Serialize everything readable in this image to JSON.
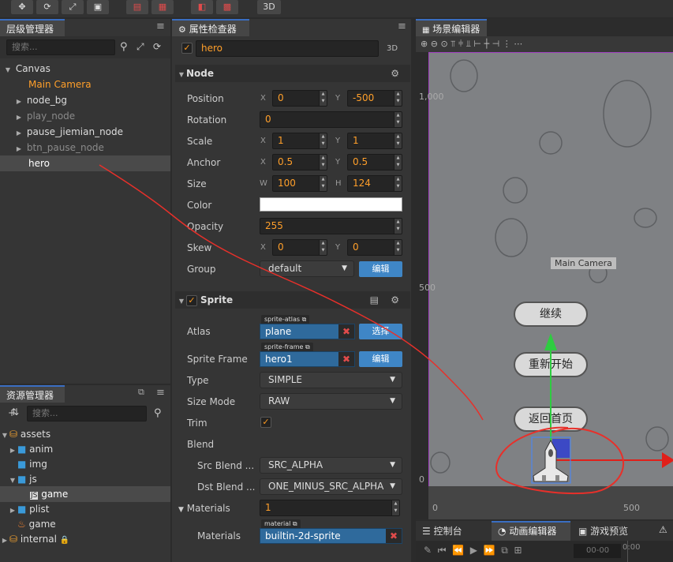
{
  "toolbar": {
    "mode_3d": "3D"
  },
  "hierarchy": {
    "title": "层级管理器",
    "search_placeholder": "搜索...",
    "nodes": [
      "Canvas",
      "Main Camera",
      "node_bg",
      "play_node",
      "pause_jiemian_node",
      "btn_pause_node",
      "hero"
    ]
  },
  "assets": {
    "title": "资源管理器",
    "search_placeholder": "搜索...",
    "items": [
      "assets",
      "anim",
      "img",
      "js",
      "game",
      "plist",
      "game",
      "internal"
    ]
  },
  "inspector": {
    "title": "属性检查器",
    "node_name": "hero",
    "mode": "3D",
    "node_section": "Node",
    "labels": {
      "position": "Position",
      "rotation": "Rotation",
      "scale": "Scale",
      "anchor": "Anchor",
      "size": "Size",
      "color": "Color",
      "opacity": "Opacity",
      "skew": "Skew",
      "group": "Group"
    },
    "axes": {
      "x": "X",
      "y": "Y",
      "w": "W",
      "h": "H"
    },
    "values": {
      "position_x": "0",
      "position_y": "-500",
      "rotation": "0",
      "scale_x": "1",
      "scale_y": "1",
      "anchor_x": "0.5",
      "anchor_y": "0.5",
      "size_w": "100",
      "size_h": "124",
      "opacity": "255",
      "skew_x": "0",
      "skew_y": "0",
      "group": "default"
    },
    "edit_label": "编辑",
    "sprite_section": "Sprite",
    "sprite_labels": {
      "atlas": "Atlas",
      "sprite_frame": "Sprite Frame",
      "type": "Type",
      "size_mode": "Size Mode",
      "trim": "Trim",
      "blend": "Blend",
      "src_blend": "Src Blend ...",
      "dst_blend": "Dst Blend ..."
    },
    "sprite_values": {
      "atlas_tag": "sprite-atlas",
      "atlas": "plane",
      "select_label": "选择",
      "frame_tag": "sprite-frame",
      "frame": "hero1",
      "type": "SIMPLE",
      "size_mode": "RAW",
      "src_blend": "SRC_ALPHA",
      "dst_blend": "ONE_MINUS_SRC_ALPHA"
    },
    "materials_label": "Materials",
    "materials_count": "1",
    "material_tag": "material",
    "material": "builtin-2d-sprite"
  },
  "scene": {
    "title": "场景编辑器",
    "y_1000": "1,000",
    "y_500": "500",
    "y_0": "0",
    "x_0": "0",
    "x_500": "500",
    "camera_label": "Main Camera",
    "btn_continue": "继续",
    "btn_restart": "重新开始",
    "btn_home": "返回首页"
  },
  "bottom": {
    "console": "控制台",
    "animation": "动画编辑器",
    "preview": "游戏预览",
    "time": "00-00",
    "time2": "0:00"
  },
  "colors": {
    "accent": "#ff9f2a",
    "select_blue": "#3f86c6",
    "annotation": "#e8302a"
  }
}
